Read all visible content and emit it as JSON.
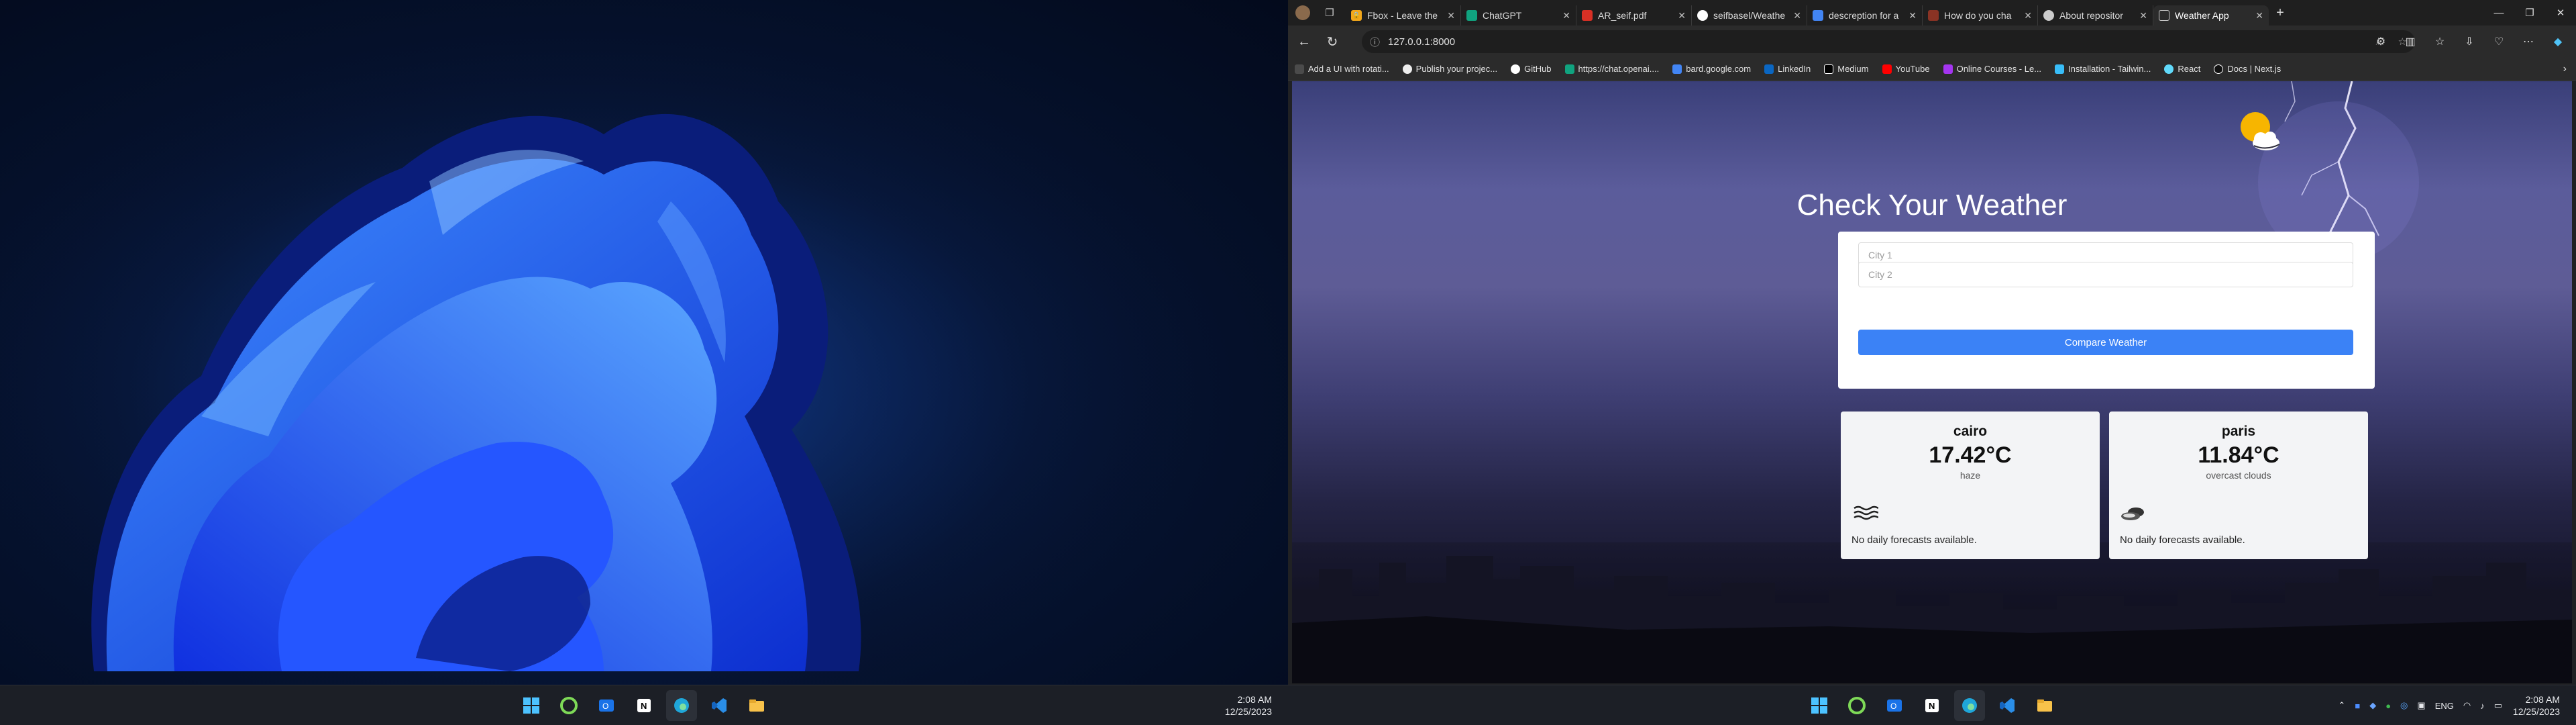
{
  "left_monitor": {
    "taskbar": {
      "apps": [
        "start-icon",
        "apps-icon",
        "outlook-icon",
        "notion-icon",
        "edge-icon",
        "vscode-icon",
        "file-explorer-icon"
      ],
      "time": "2:08 AM",
      "date": "12/25/2023"
    }
  },
  "browser": {
    "tabs": [
      {
        "label": "Fbox - Leave the",
        "icon": "fbox-icon"
      },
      {
        "label": "ChatGPT",
        "icon": "chatgpt-icon"
      },
      {
        "label": "AR_seif.pdf",
        "icon": "pdf-icon"
      },
      {
        "label": "seifbasel/Weathe",
        "icon": "github-icon"
      },
      {
        "label": "descreption for a",
        "icon": "search-icon"
      },
      {
        "label": "How do you cha",
        "icon": "link-icon"
      },
      {
        "label": "About repositor",
        "icon": "github-icon"
      },
      {
        "label": "Weather App",
        "icon": "page-icon"
      }
    ],
    "url": "127.0.0.1:8000",
    "bookmarks": [
      "Add a UI with rotati...",
      "Publish your projec...",
      "GitHub",
      "https://chat.openai....",
      "bard.google.com",
      "LinkedIn",
      "Medium",
      "YouTube",
      "Online Courses - Le...",
      "Installation - Tailwin...",
      "React",
      "Docs | Next.js"
    ],
    "bookmark_colors": [
      "#4b4b4b",
      "#2b2b2b",
      "#2b2b2b",
      "#10a37f",
      "#4285f4",
      "#0a66c2",
      "#000000",
      "#ff0000",
      "#a435f0",
      "#38bdf8",
      "#61dafb",
      "#111111"
    ]
  },
  "weather_page": {
    "title": "Check Your Weather",
    "city1_placeholder": "City 1",
    "city2_placeholder": "City 2",
    "button_label": "Compare Weather",
    "cards": [
      {
        "city": "cairo",
        "temp": "17.42°C",
        "desc": "haze",
        "icon": "haze-icon",
        "note": "No daily forecasts available."
      },
      {
        "city": "paris",
        "temp": "11.84°C",
        "desc": "overcast clouds",
        "icon": "overcast-clouds-icon",
        "note": "No daily forecasts available."
      }
    ],
    "accent_color": "#3b82f6"
  },
  "right_taskbar": {
    "lang": "ENG",
    "time": "2:08 AM",
    "date": "12/25/2023"
  }
}
